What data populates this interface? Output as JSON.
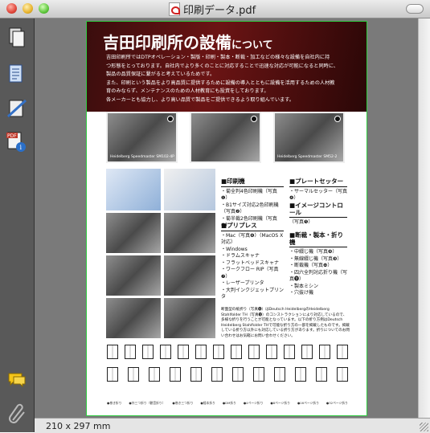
{
  "window": {
    "title": "印刷データ.pdf"
  },
  "sidebar": {
    "icons": [
      "pages-icon",
      "document-icon",
      "annotation-icon",
      "pdf-info-icon",
      "notes-icon",
      "attachment-icon"
    ]
  },
  "status": {
    "page_size": "210 x 297 mm"
  },
  "page": {
    "banner_title": "吉田印刷所の設備",
    "banner_title_suffix": "について",
    "banner_text": [
      "吉田印刷所ではDTPオペレーション・製版・印刷・製本・断裁・加工などの様々な設備を自社内に持",
      "つ形態をとっております。自社内でより多くのことに対応することで迅速な対応が可能になると同時に、",
      "製品の品質保証に繋がると考えているためです。",
      "また、印刷という製品をより高品質に提供するために設備の導入とともに設備を活用するための人材教",
      "育のみならず、メンテナンスのための人材教育にも投資をしております。",
      "各メーカーとも協力し、より高い品質で製品をご提供できるよう取り組んでいます。"
    ],
    "photo_captions": [
      "Heidelberg Speedmaster SM102-4P",
      "",
      "Heidelberg Speedmaster SM52-2"
    ],
    "sections": {
      "press": {
        "title": "■印刷機",
        "items": [
          "・菊全判4色印刷機（写真❶）",
          "・B1サイズ対応2色印刷機（写真❷）",
          "・菊半裁2色印刷機（写真❸）"
        ]
      },
      "platesetter": {
        "title": "■プレートセッター",
        "items": [
          "・サーマルセッター（写真❹）"
        ]
      },
      "imagecontrol": {
        "title": "■イメージコントロール",
        "items": [
          "（写真❺）"
        ]
      },
      "prepress": {
        "title": "■プリプレス",
        "items": [
          "・Mac（写真❻）（MacOS X 対応）",
          "・Windows",
          "・ドラムスキャナ",
          "・フラットベッドスキャナ",
          "・ワークフロー RIP（写真❼）",
          "・レーザープリンタ",
          "・大判インクジェットプリンタ"
        ]
      },
      "binding": {
        "title": "■断裁・製本・折り機",
        "items": [
          "・中綴じ機（写真❽）",
          "・無線綴じ機（写真❾）",
          "・断裁機（写真❿）",
          "・四六全判対応折り機（写真⓫）",
          "・製本ミシン",
          "・穴抜け機"
        ]
      }
    },
    "note": "断面型の紙折り（写真⓬）はDeutsch HeidelbergのHeidelberg Stahlfolder TH（写真⓭）のコンストラクションにより対応しているので、多様な折りを行うことが可能となっています。以下の折り方例はDeutsch Heidelberg Stahlfolder THで可能な折り方の一部を掲載したものです。掲載している折り方以外にも対応している折り方があります。折りについてのお問い合わせはお気軽にお問い合わせください。",
    "fold_labels": [
      "●巻き折り",
      "●外三つ折り（観音折り）",
      "●巻き三つ折り",
      "●経本折り",
      "●DM折り",
      "●4ページ折り",
      "●8ページ折り",
      "●16ページ折り",
      "●32ページ折り"
    ]
  }
}
